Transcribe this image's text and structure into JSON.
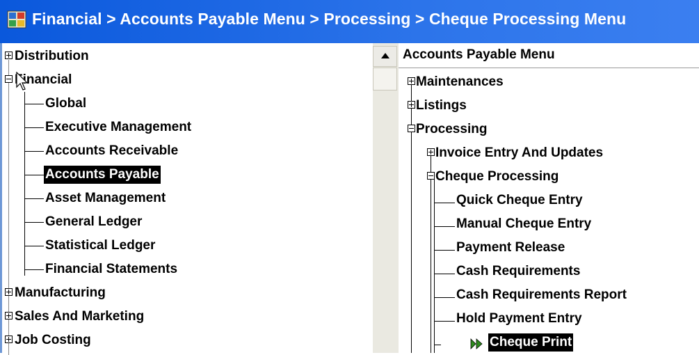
{
  "window": {
    "title": "Financial > Accounts Payable Menu > Processing > Cheque Processing Menu"
  },
  "left_tree": {
    "items": [
      {
        "label": "Distribution",
        "expander": "plus"
      },
      {
        "label": "Financial",
        "expander": "minus"
      },
      {
        "label": "Global"
      },
      {
        "label": "Executive Management"
      },
      {
        "label": "Accounts Receivable"
      },
      {
        "label": "Accounts Payable",
        "selected": true
      },
      {
        "label": "Asset Management"
      },
      {
        "label": "General Ledger"
      },
      {
        "label": "Statistical Ledger"
      },
      {
        "label": "Financial Statements"
      },
      {
        "label": "Manufacturing",
        "expander": "plus"
      },
      {
        "label": "Sales And Marketing",
        "expander": "plus"
      },
      {
        "label": "Job Costing",
        "expander": "plus"
      }
    ]
  },
  "right_tree": {
    "header": "Accounts Payable Menu",
    "items": [
      {
        "label": "Maintenances",
        "expander": "plus"
      },
      {
        "label": "Listings",
        "expander": "plus"
      },
      {
        "label": "Processing",
        "expander": "minus"
      },
      {
        "label": "Invoice Entry And Updates",
        "expander": "plus"
      },
      {
        "label": "Cheque Processing",
        "expander": "minus"
      },
      {
        "label": "Quick Cheque Entry"
      },
      {
        "label": "Manual Cheque Entry"
      },
      {
        "label": "Payment Release"
      },
      {
        "label": "Cash Requirements"
      },
      {
        "label": "Cash Requirements Report"
      },
      {
        "label": "Hold Payment Entry"
      },
      {
        "label": "Cheque Print",
        "selected": true,
        "icon": "play-arrow-icon"
      }
    ]
  },
  "colors": {
    "titlebar": "#0a58dc",
    "selection": "#000000",
    "arrow_icon": "#2e8b1e"
  }
}
